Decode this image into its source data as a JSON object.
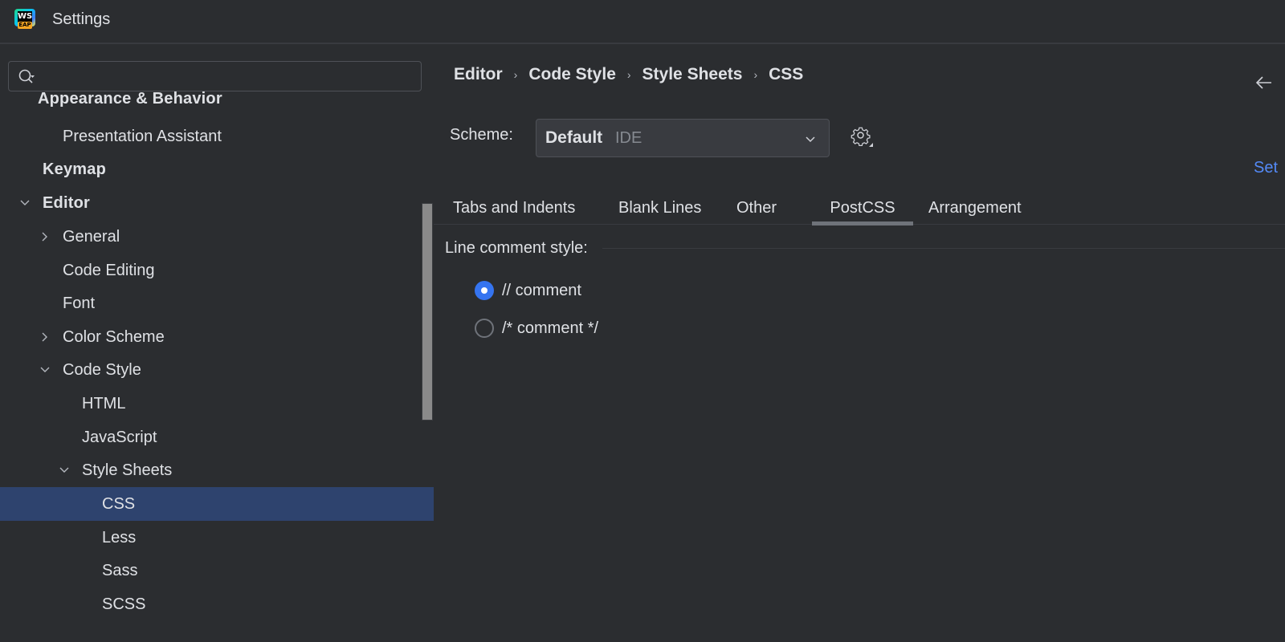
{
  "window": {
    "title": "Settings",
    "app_icon": "webstorm-eap-logo",
    "app_icon_text": "WS",
    "app_icon_badge": "EAP"
  },
  "sidebar": {
    "search": {
      "placeholder": "",
      "value": "",
      "icon": "search-icon"
    },
    "items": [
      {
        "label": "Appearance & Behavior",
        "level": 0,
        "bold": true,
        "expanded": true,
        "chevron": "none"
      },
      {
        "label": "Presentation Assistant",
        "level": 1,
        "bold": false,
        "chevron": "none"
      },
      {
        "label": "Keymap",
        "level": 0,
        "bold": true,
        "chevron": "none"
      },
      {
        "label": "Editor",
        "level": 0,
        "bold": true,
        "chevron": "down"
      },
      {
        "label": "General",
        "level": 1,
        "bold": false,
        "chevron": "right"
      },
      {
        "label": "Code Editing",
        "level": 1,
        "bold": false,
        "chevron": "none"
      },
      {
        "label": "Font",
        "level": 1,
        "bold": false,
        "chevron": "none"
      },
      {
        "label": "Color Scheme",
        "level": 1,
        "bold": false,
        "chevron": "right"
      },
      {
        "label": "Code Style",
        "level": 1,
        "bold": false,
        "chevron": "down"
      },
      {
        "label": "HTML",
        "level": 2,
        "bold": false,
        "chevron": "none"
      },
      {
        "label": "JavaScript",
        "level": 2,
        "bold": false,
        "chevron": "none"
      },
      {
        "label": "Style Sheets",
        "level": 2,
        "bold": false,
        "chevron": "down"
      },
      {
        "label": "CSS",
        "level": 3,
        "bold": false,
        "chevron": "none",
        "selected": true
      },
      {
        "label": "Less",
        "level": 3,
        "bold": false,
        "chevron": "none"
      },
      {
        "label": "Sass",
        "level": 3,
        "bold": false,
        "chevron": "none"
      },
      {
        "label": "SCSS",
        "level": 3,
        "bold": false,
        "chevron": "none"
      }
    ]
  },
  "main": {
    "breadcrumb": [
      "Editor",
      "Code Style",
      "Style Sheets",
      "CSS"
    ],
    "breadcrumb_separator": "›",
    "back_icon": "arrow-left-icon",
    "scheme": {
      "label": "Scheme:",
      "value": "Default",
      "tag": "IDE"
    },
    "set_link": "Set",
    "tabs": [
      {
        "label": "Tabs and Indents",
        "active": false
      },
      {
        "label": "Blank Lines",
        "active": false
      },
      {
        "label": "Other",
        "active": false
      },
      {
        "label": "PostCSS",
        "active": true
      },
      {
        "label": "Arrangement",
        "active": false
      }
    ],
    "line_comment": {
      "title": "Line comment style:",
      "options": [
        {
          "label": "// comment",
          "checked": true
        },
        {
          "label": "/* comment */",
          "checked": false
        }
      ]
    }
  },
  "colors": {
    "background": "#2b2d30",
    "selection": "#2e436e",
    "accent": "#3574f0",
    "link": "#548af7",
    "text": "#dfe1e5",
    "muted": "#868a91"
  }
}
